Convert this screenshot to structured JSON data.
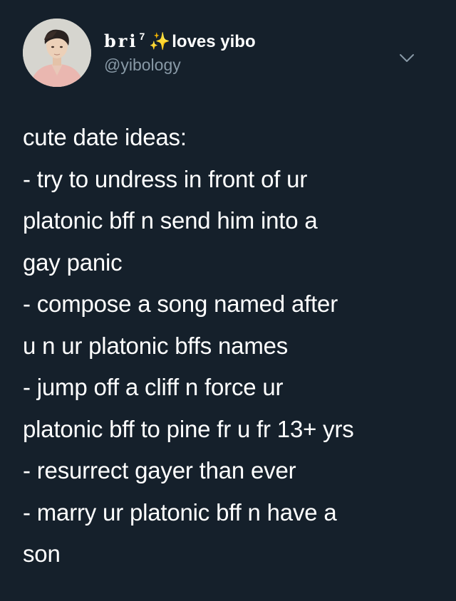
{
  "author": {
    "display_name_stylized": "bri",
    "display_name_superscript": "7",
    "display_name_emoji": "✨",
    "display_name_text": "loves yibo",
    "handle": "@yibology",
    "avatar_icon": "profile-photo"
  },
  "menu_icon": "chevron-down-icon",
  "tweet": {
    "lines": [
      "cute date ideas:",
      "- try to undress in front of ur",
      "platonic bff n send him into a",
      "gay panic",
      "- compose a song named after",
      "u n ur platonic bffs names",
      "- jump off a cliff n force ur",
      "platonic bff to pine fr u fr 13+ yrs",
      "- resurrect gayer than ever",
      "- marry ur platonic bff n have a",
      "son"
    ]
  },
  "colors": {
    "background": "#15202b",
    "text": "#ffffff",
    "secondary_text": "#8899a6",
    "sparkles": "#f7d547"
  }
}
